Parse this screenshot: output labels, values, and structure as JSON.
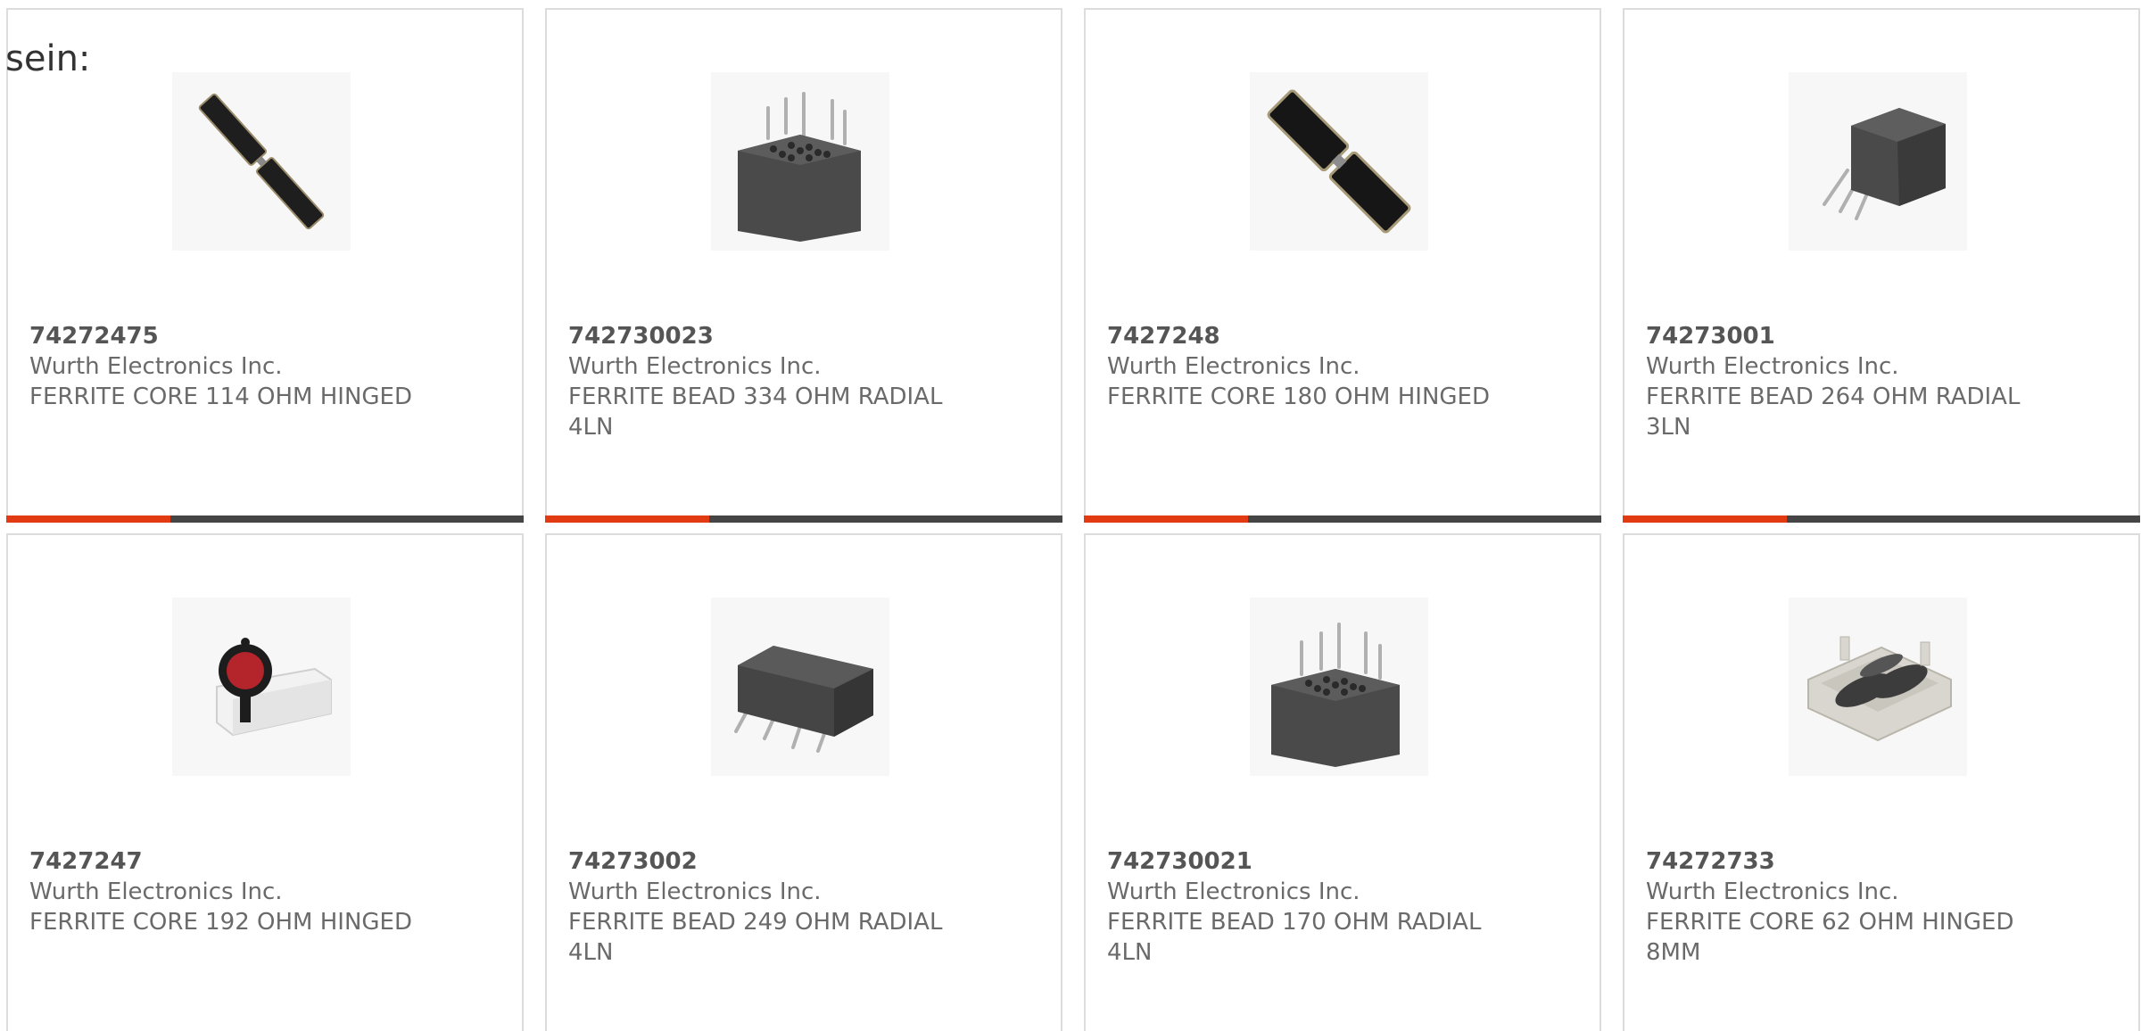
{
  "lead_text": "sein:",
  "products": [
    {
      "part_number": "74272475",
      "manufacturer": "Wurth Electronics Inc.",
      "description": "FERRITE CORE 114 OHM HINGED",
      "image_icon": "ferrite-core-hinged-long-icon"
    },
    {
      "part_number": "742730023",
      "manufacturer": "Wurth Electronics Inc.",
      "description": "FERRITE BEAD 334 OHM RADIAL 4LN",
      "image_icon": "ferrite-bead-radial-4ln-icon"
    },
    {
      "part_number": "7427248",
      "manufacturer": "Wurth Electronics Inc.",
      "description": "FERRITE CORE 180 OHM HINGED",
      "image_icon": "ferrite-core-hinged-wide-icon"
    },
    {
      "part_number": "74273001",
      "manufacturer": "Wurth Electronics Inc.",
      "description": "FERRITE BEAD 264 OHM RADIAL 3LN",
      "image_icon": "ferrite-bead-radial-3ln-icon"
    },
    {
      "part_number": "7427247",
      "manufacturer": "Wurth Electronics Inc.",
      "description": "FERRITE CORE 192 OHM HINGED",
      "image_icon": "ferrite-core-hinged-white-icon"
    },
    {
      "part_number": "74273002",
      "manufacturer": "Wurth Electronics Inc.",
      "description": "FERRITE BEAD 249 OHM RADIAL 4LN",
      "image_icon": "ferrite-bead-radial-2row-icon"
    },
    {
      "part_number": "742730021",
      "manufacturer": "Wurth Electronics Inc.",
      "description": "FERRITE BEAD 170 OHM RADIAL 4LN",
      "image_icon": "ferrite-bead-radial-4ln-icon"
    },
    {
      "part_number": "74272733",
      "manufacturer": "Wurth Electronics Inc.",
      "description": "FERRITE CORE 62 OHM HINGED 8MM",
      "image_icon": "ferrite-core-clamp-icon"
    }
  ],
  "colors": {
    "accent_bar": "#e23b14",
    "dark_bar": "#454545",
    "card_border": "#dcdcdc"
  }
}
